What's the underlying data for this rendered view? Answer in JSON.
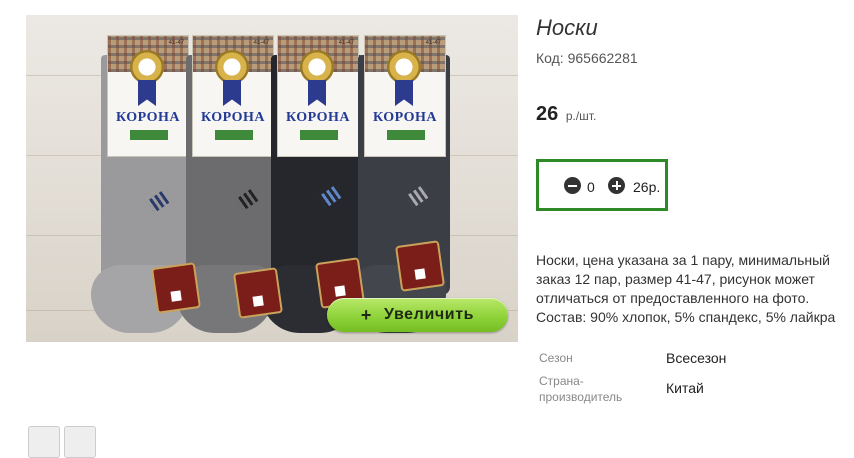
{
  "product": {
    "title": "Носки",
    "code": "Код: 965662281",
    "price": "26",
    "unit": "р./шт.",
    "description": "Носки, цена указана за 1 пару, минимальный заказ 12 пар, размер 41-47, рисунок может отличаться от предоставленного на фото. Состав: 90% хлопок, 5% спандекс, 5% лайкра"
  },
  "quantity": {
    "value": "0",
    "sum": "26р."
  },
  "image": {
    "zoom_label": "Увеличить",
    "zoom_plus": "+",
    "brand": "КОРОНА",
    "size_label": "41-47"
  },
  "specs": [
    {
      "label": "Сезон",
      "value": "Всесезон"
    },
    {
      "label": "Страна-производитель",
      "value": "Китай"
    }
  ],
  "colors": {
    "accent_green": "#2d8a27",
    "button_green": "#8fd33a"
  }
}
